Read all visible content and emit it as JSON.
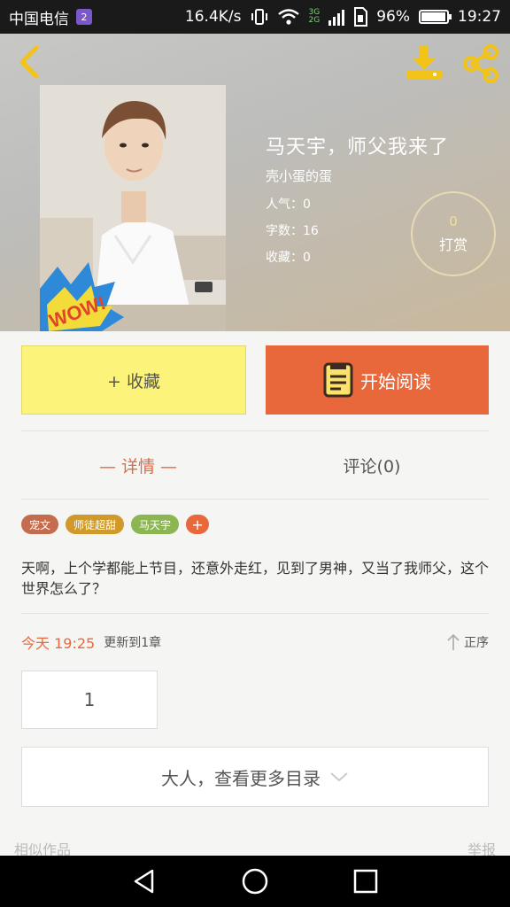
{
  "status_bar": {
    "carrier": "中国电信",
    "sim_badge": "2",
    "speed": "16.4K/s",
    "net_type_top": "3G",
    "net_type_bottom": "2G",
    "battery": "96%",
    "battery_level": 0.96,
    "time": "19:27"
  },
  "book": {
    "title": "马天宇，师父我来了",
    "author": "壳小蛋的蛋",
    "popularity": "人气：0",
    "word_count": "字数：16",
    "favorites": "收藏：0",
    "cover_badge": "WOW!"
  },
  "reward": {
    "count": "0",
    "label": "打赏"
  },
  "actions": {
    "collect_label": "+ 收藏",
    "read_label": "开始阅读"
  },
  "tabs": {
    "detail": "— 详情 —",
    "comment": "评论(0)"
  },
  "tags": [
    {
      "label": "宠文",
      "color": "#c66c4e"
    },
    {
      "label": "师徒超甜",
      "color": "#d09a2b"
    },
    {
      "label": "马天宇",
      "color": "#8cb652"
    }
  ],
  "tag_add": "+",
  "description": "天啊，上个学都能上节目，还意外走红，见到了男神，又当了我师父，这个世界怎么了？",
  "update": {
    "time": "今天 19:25",
    "text": "更新到1章",
    "order": "正序"
  },
  "chapter_number": "1",
  "more_catalog": "大人，查看更多目录",
  "footer": {
    "similar": "相似作品",
    "report": "举报"
  },
  "colors": {
    "accent": "#e8683c",
    "collect_bg": "#fcf47a"
  }
}
